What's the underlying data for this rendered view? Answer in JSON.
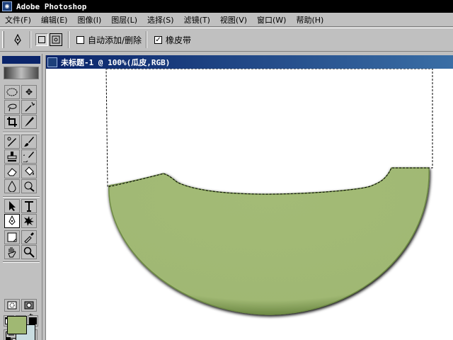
{
  "app": {
    "title": "Adobe Photoshop",
    "icon": "photoshop-eye-icon"
  },
  "menu": [
    "文件(F)",
    "编辑(E)",
    "图像(I)",
    "图层(L)",
    "选择(S)",
    "滤镜(T)",
    "视图(V)",
    "窗口(W)",
    "帮助(H)"
  ],
  "options": {
    "tool_icon": "pen-icon",
    "auto_add_delete": {
      "label": "自动添加/删除",
      "checked": false
    },
    "rubber_band": {
      "label": "橡皮带",
      "checked": true
    }
  },
  "document": {
    "title": "未标题-1 @ 100%(瓜皮,RGB)"
  },
  "colors": {
    "foreground": "#a0b873",
    "background": "#c8dce0",
    "melon_fill": "#a0b873",
    "melon_edge": "#6e8a45",
    "title_bar": "#0a246a"
  },
  "tools": [
    "marquee",
    "move",
    "lasso",
    "magic-wand",
    "crop",
    "slice",
    "healing-brush",
    "brush",
    "clone-stamp",
    "history-brush",
    "eraser",
    "paint-bucket",
    "blur",
    "dodge",
    "path-selection",
    "type",
    "pen",
    "custom-shape",
    "notes",
    "eyedropper",
    "hand",
    "zoom"
  ]
}
